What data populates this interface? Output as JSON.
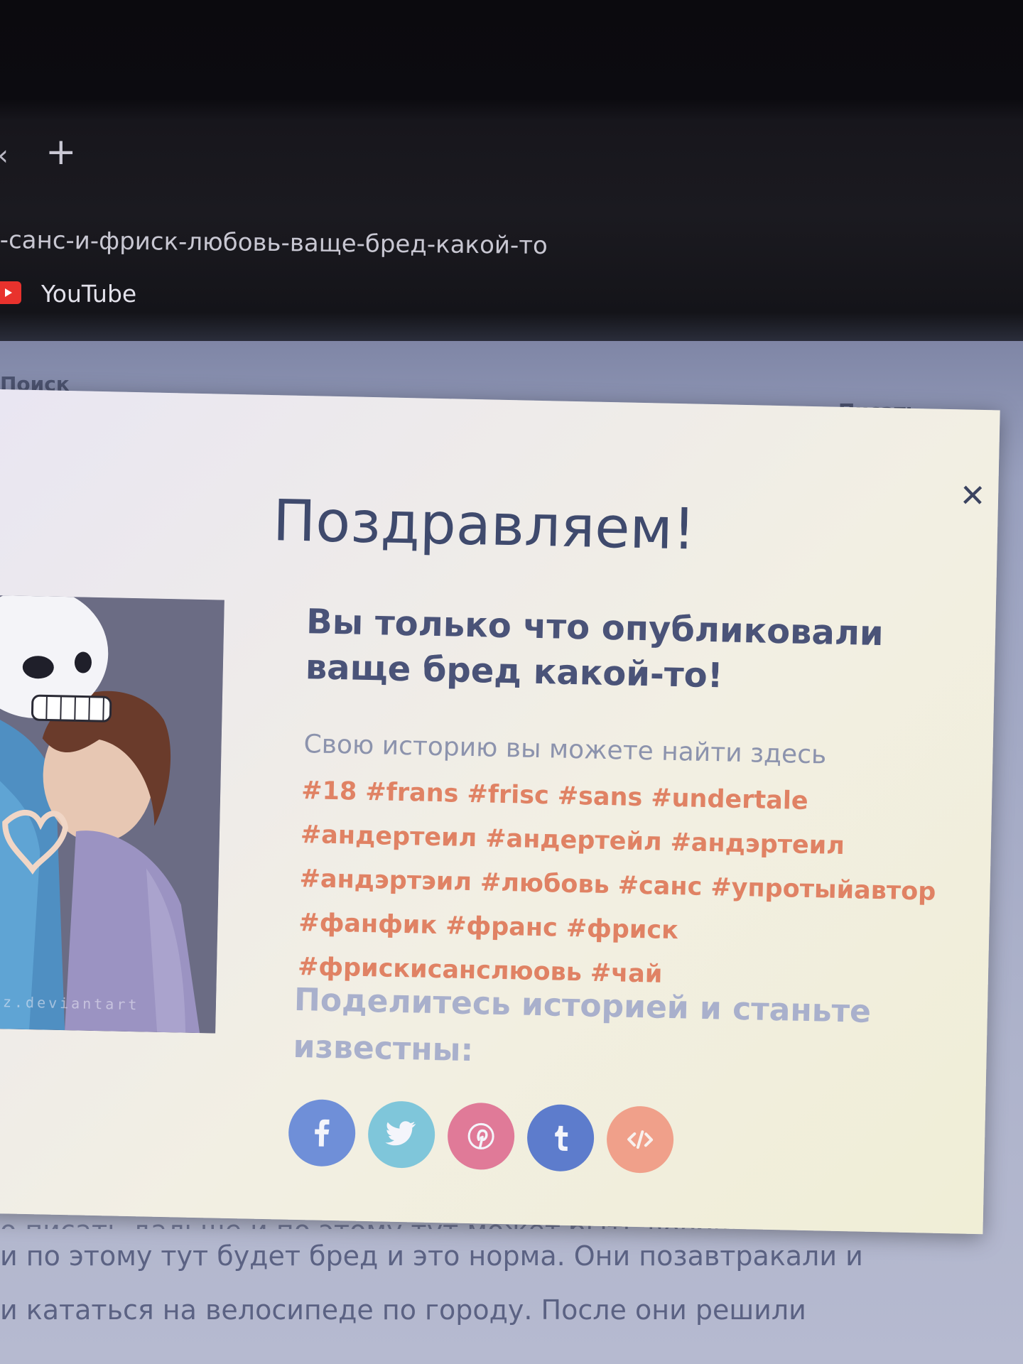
{
  "browser": {
    "tab_scroll_glyph": "‹",
    "new_tab_glyph": "+",
    "address_text": "-санс-и-фриск-любовь-ваще-бред-какой-то",
    "bookmarks": [
      {
        "label": "YouTube",
        "icon": "youtube-icon"
      }
    ]
  },
  "background_page": {
    "label_left": "Поиск",
    "label_right": "Писать",
    "story_lines": [
      "о писать дальше и по этому тут может быть вообще что",
      "и по этому тут будет бред и это норма. Они позавтракали и",
      "и кататься на велосипеде по городу. После они решили"
    ]
  },
  "modal": {
    "close_glyph": "✕",
    "title": "Поздравляем!",
    "published_message": "Вы только что опубликовали ваще бред какой-то!",
    "find_story_label": "Свою историю вы можете найти здесь",
    "tags": [
      "#18",
      "#frans",
      "#frisc",
      "#sans",
      "#undertale",
      "#андертеил",
      "#андертейл",
      "#андэртеил",
      "#андэртэил",
      "#любовь",
      "#санс",
      "#упротыйавтор",
      "#фанфик",
      "#франс",
      "#фриск",
      "#фрискисанслюовь",
      "#чай"
    ],
    "share_heading": "Поделитесь историей и станьте известны:",
    "cover_watermark": "nz.deviantart",
    "share_buttons": [
      {
        "name": "facebook",
        "icon": "facebook-icon",
        "color": "#6f8fd8"
      },
      {
        "name": "twitter",
        "icon": "twitter-icon",
        "color": "#7fc6da"
      },
      {
        "name": "pinterest",
        "icon": "pinterest-icon",
        "color": "#e07a98"
      },
      {
        "name": "tumblr",
        "icon": "tumblr-icon",
        "color": "#5d7ccc"
      },
      {
        "name": "embed",
        "icon": "embed-icon",
        "color": "#f0a08a"
      }
    ]
  }
}
